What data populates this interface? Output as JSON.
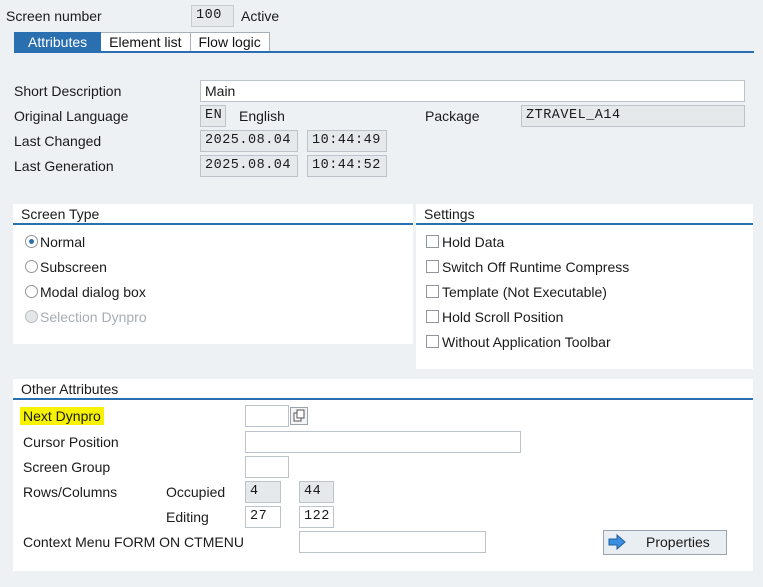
{
  "header": {
    "screen_number_label": "Screen number",
    "screen_number": "100",
    "status": "Active"
  },
  "tabs": [
    {
      "label": "Attributes",
      "active": true
    },
    {
      "label": "Element list",
      "active": false
    },
    {
      "label": "Flow logic",
      "active": false
    }
  ],
  "attributes": {
    "short_description_label": "Short Description",
    "short_description": "Main",
    "original_language_label": "Original Language",
    "language_code": "EN",
    "language_name": "English",
    "package_label": "Package",
    "package": "ZTRAVEL_A14",
    "last_changed_label": "Last Changed",
    "last_changed_date": "2025.08.04",
    "last_changed_time": "10:44:49",
    "last_generation_label": "Last Generation",
    "last_generation_date": "2025.08.04",
    "last_generation_time": "10:44:52"
  },
  "screen_type": {
    "title": "Screen Type",
    "options": [
      {
        "label": "Normal",
        "selected": true,
        "disabled": false
      },
      {
        "label": "Subscreen",
        "selected": false,
        "disabled": false
      },
      {
        "label": "Modal dialog box",
        "selected": false,
        "disabled": false
      },
      {
        "label": "Selection Dynpro",
        "selected": false,
        "disabled": true
      }
    ]
  },
  "settings": {
    "title": "Settings",
    "options": [
      {
        "label": "Hold Data",
        "checked": false
      },
      {
        "label": "Switch Off Runtime Compress",
        "checked": false
      },
      {
        "label": "Template (Not Executable)",
        "checked": false
      },
      {
        "label": "Hold Scroll Position",
        "checked": false
      },
      {
        "label": "Without Application Toolbar",
        "checked": false
      }
    ]
  },
  "other_attributes": {
    "title": "Other Attributes",
    "next_dynpro_label": "Next Dynpro",
    "next_dynpro_value": "",
    "cursor_position_label": "Cursor Position",
    "cursor_position_value": "",
    "screen_group_label": "Screen Group",
    "screen_group_value": "",
    "rows_columns_label": "Rows/Columns",
    "occupied_label": "Occupied",
    "occupied_rows": "4",
    "occupied_cols": "44",
    "editing_label": "Editing",
    "editing_rows": "27",
    "editing_cols": "122",
    "context_menu_label": "Context Menu FORM ON CTMENU",
    "context_menu_value": "",
    "properties_button": "Properties"
  },
  "colors": {
    "accent": "#2a6fb0",
    "highlight": "#f6f200",
    "background": "#eef1f4"
  }
}
